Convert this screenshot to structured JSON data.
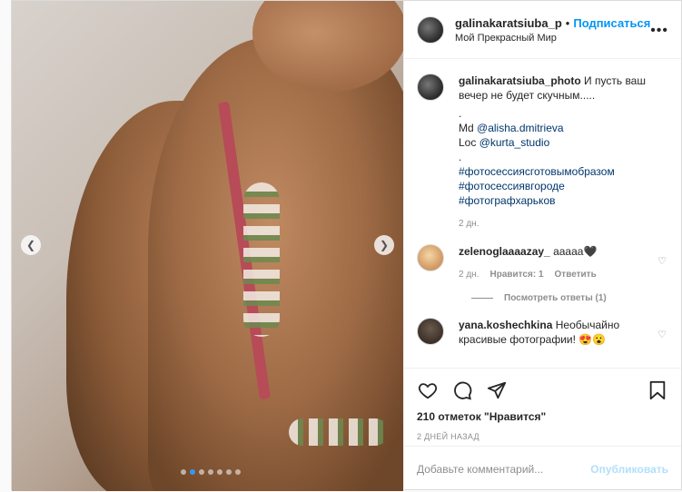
{
  "header": {
    "username": "galinakaratsiuba_p",
    "separator": "•",
    "follow_label": "Подписаться",
    "location": "Мой Прекрасный Мир",
    "more_icon": "more-horizontal-icon"
  },
  "caption": {
    "username": "galinakaratsiuba_photo",
    "text_1": " И пусть ваш вечер не будет скучным.....",
    "dot_1": ".",
    "md_prefix": "Md ",
    "md_mention": "@alisha.dmitrieva",
    "loc_prefix": "Loc ",
    "loc_mention": "@kurta_studio",
    "dot_2": ".",
    "hashtags": [
      "#фотосессиясготовымобразом",
      "#фотосессиявгороде",
      "#фотографхарьков"
    ],
    "time": "2 дн."
  },
  "comments": [
    {
      "username": "zelenoglaaaazay_",
      "text": " ааааа🖤",
      "time": "2 дн.",
      "likes": "Нравится: 1",
      "reply": "Ответить"
    },
    {
      "username": "yana.koshechkina",
      "text": " Необычайно красивые фотографии! 😍😮"
    }
  ],
  "replies_label": "Посмотреть ответы (1)",
  "actions": {
    "likes": "210 отметок \"Нравится\"",
    "date": "2 ДНЕЙ НАЗАД"
  },
  "add_comment": {
    "placeholder": "Добавьте комментарий...",
    "publish": "Опубликовать"
  },
  "carousel": {
    "prev_icon": "chevron-left-icon",
    "next_icon": "chevron-right-icon",
    "slide_count": 7,
    "active_slide": 2
  },
  "colors": {
    "accent": "#0095f6",
    "link": "#00376b",
    "muted": "#8e8e8e",
    "publish_disabled": "#b2dffc"
  }
}
